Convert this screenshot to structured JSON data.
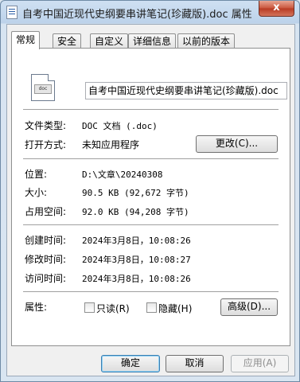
{
  "window": {
    "title": "自考中国近现代史纲要串讲笔记(珍藏版).doc 属性",
    "close_glyph": "x"
  },
  "tabs": [
    "常规",
    "安全",
    "自定义",
    "详细信息",
    "以前的版本"
  ],
  "file": {
    "name": "自考中国近现代史纲要串讲笔记(珍藏版).doc",
    "icon": "word-document-icon",
    "icon_text": "doc"
  },
  "props": {
    "type": {
      "label": "文件类型:",
      "value": "DOC 文档 (.doc)"
    },
    "opens_with": {
      "label": "打开方式:",
      "value": "未知应用程序",
      "button": "更改(C)..."
    },
    "location": {
      "label": "位置:",
      "value": "D:\\文章\\20240308"
    },
    "size": {
      "label": "大小:",
      "value": "90.5 KB (92,672 字节)"
    },
    "size_on_disk": {
      "label": "占用空间:",
      "value": "92.0 KB (94,208 字节)"
    },
    "created": {
      "label": "创建时间:",
      "value": "2024年3月8日，10:08:26"
    },
    "modified": {
      "label": "修改时间:",
      "value": "2024年3月8日，10:08:27"
    },
    "accessed": {
      "label": "访问时间:",
      "value": "2024年3月8日，10:08:26"
    },
    "attributes": {
      "label": "属性:",
      "readonly": "只读(R)",
      "hidden": "隐藏(H)",
      "advanced": "高级(D)..."
    }
  },
  "buttons": {
    "ok": "确定",
    "cancel": "取消",
    "apply": "应用(A)"
  }
}
